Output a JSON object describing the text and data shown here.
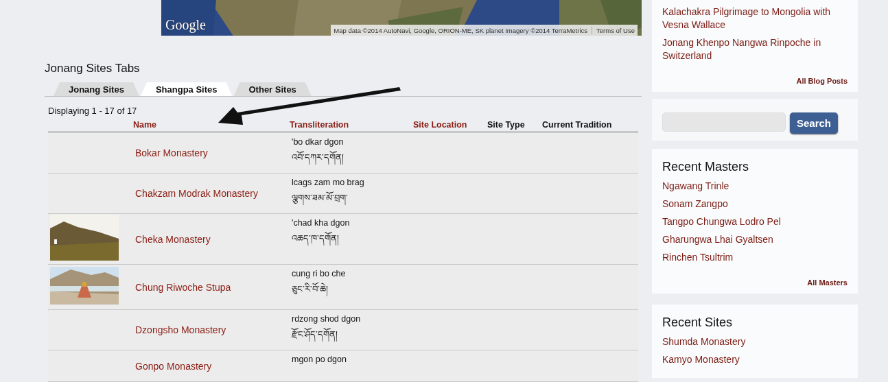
{
  "map": {
    "logo": "Google",
    "attribution": "Map data ©2014 AutoNavi, Google, ORION-ME, SK planet Imagery ©2014 TerraMetrics",
    "terms": "Terms of Use"
  },
  "section_title": "Jonang Sites Tabs",
  "tabs": [
    {
      "label": "Jonang Sites",
      "selected": false
    },
    {
      "label": "Shangpa Sites",
      "selected": true
    },
    {
      "label": "Other Sites",
      "selected": false
    }
  ],
  "displaying": "Displaying 1 - 17 of 17",
  "table": {
    "columns": [
      {
        "label": "Name",
        "kind": "link"
      },
      {
        "label": "Transliteration",
        "kind": "link"
      },
      {
        "label": "Site Location",
        "kind": "link"
      },
      {
        "label": "Site Type",
        "kind": "plain"
      },
      {
        "label": "Current Tradition",
        "kind": "plain"
      }
    ],
    "rows": [
      {
        "name": "Bokar Monastery",
        "transliteration": "'bo dkar dgon",
        "tibetan": "འབོ་དཀར་དགོན།"
      },
      {
        "name": "Chakzam Modrak Monastery",
        "transliteration": "lcags zam mo brag",
        "tibetan": "ལྕགས་ཟམ་མོ་བྲག་"
      },
      {
        "name": "Cheka Monastery",
        "transliteration": "'chad kha dgon",
        "tibetan": "འཆད་ཁ་དགོན།"
      },
      {
        "name": "Chung Riwoche Stupa",
        "transliteration": "cung ri bo che",
        "tibetan": "ཅུང་རི་བོ་ཆེ།"
      },
      {
        "name": "Dzongsho Monastery",
        "transliteration": "rdzong shod dgon",
        "tibetan": "རྫོང་ཤོད་དགོན།"
      },
      {
        "name": "Gonpo Monastery",
        "transliteration": "mgon po dgon"
      }
    ]
  },
  "sidebar": {
    "blog_posts": [
      "Kalachakra Pilgrimage to Mongolia with Vesna Wallace",
      "Jonang Khenpo Nangwa Rinpoche in Switzerland"
    ],
    "all_blog_posts": "All Blog Posts",
    "search": {
      "button": "Search"
    },
    "recent_masters": {
      "title": "Recent Masters",
      "items": [
        "Ngawang Trinle",
        "Sonam Zangpo",
        "Tangpo Chungwa Lodro Pel",
        "Gharungwa Lhai Gyaltsen",
        "Rinchen Tsultrim"
      ],
      "more": "All Masters"
    },
    "recent_sites": {
      "title": "Recent Sites",
      "items": [
        "Shumda Monastery",
        "Kamyo Monastery"
      ]
    }
  }
}
